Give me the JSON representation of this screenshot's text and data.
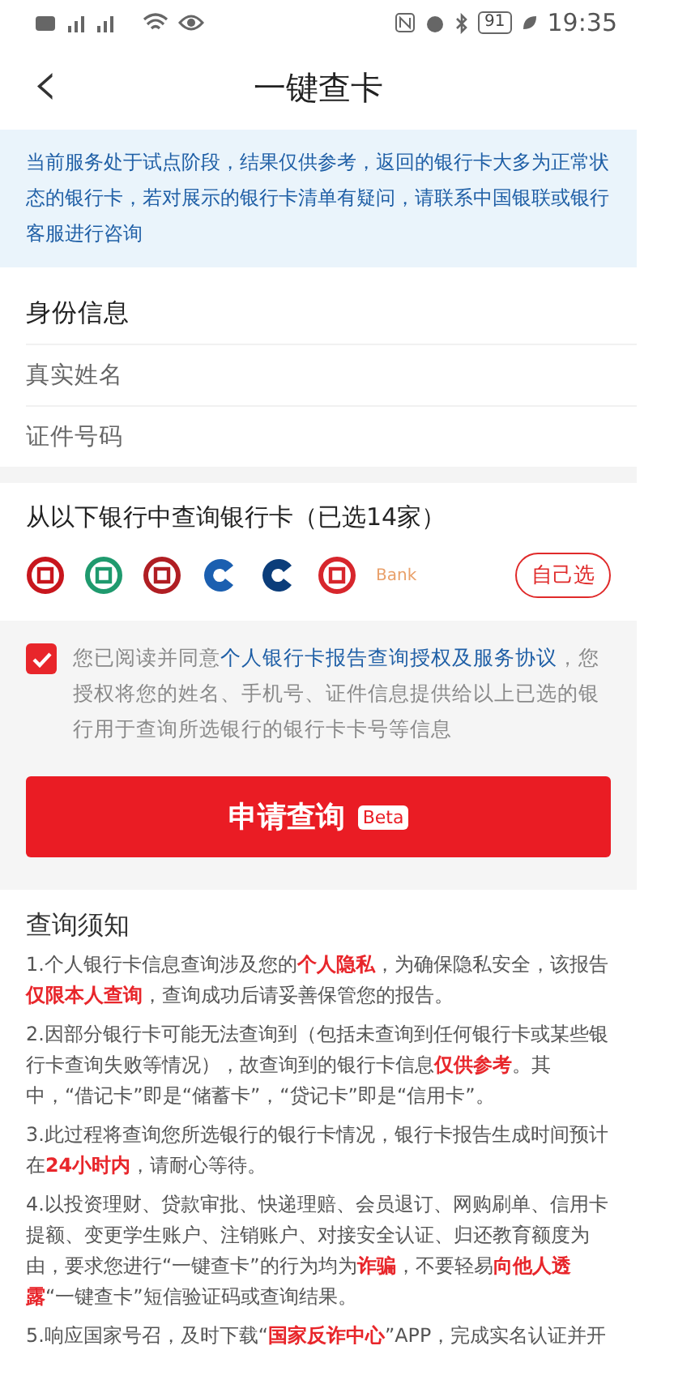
{
  "status_bar": {
    "battery": "91",
    "time": "19:35"
  },
  "nav": {
    "back": "‹",
    "title": "一键查卡"
  },
  "notice": "当前服务处于试点阶段，结果仅供参考，返回的银行卡大多为正常状态的银行卡，若对展示的银行卡清单有疑问，请联系中国银联或银行客服进行咨询",
  "identity": {
    "title": "身份信息",
    "fields": [
      {
        "label": "真实姓名"
      },
      {
        "label": "证件号码"
      }
    ]
  },
  "banks": {
    "title": "从以下银行中查询银行卡（已选14家）",
    "items": [
      {
        "kind": "ring",
        "color": "#c8161d"
      },
      {
        "kind": "ring",
        "color": "#1f9a6e"
      },
      {
        "kind": "ring",
        "color": "#b01e23"
      },
      {
        "kind": "swoosh",
        "color": "#1b5fb0"
      },
      {
        "kind": "swoosh",
        "color": "#0b3d7a"
      },
      {
        "kind": "ring",
        "color": "#d7262c"
      },
      {
        "kind": "text",
        "color": "#e9a06a",
        "label": "Bank"
      }
    ],
    "choose_button": "自己选"
  },
  "agreement": {
    "checked": true,
    "prefix": "您已阅读并同意",
    "link": "个人银行卡报告查询授权及服务协议",
    "suffix": "，您授权将您的姓名、手机号、证件信息提供给以上已选的银行用于查询所选银行的银行卡卡号等信息"
  },
  "submit": {
    "label": "申请查询",
    "badge": "Beta"
  },
  "notes": {
    "title": "查询须知",
    "items": [
      "1.个人银行卡信息查询涉及您的**个人隐私**，为确保隐私安全，该报告**仅限本人查询**，查询成功后请妥善保管您的报告。",
      "2.因部分银行卡可能无法查询到（包括未查询到任何银行卡或某些银行卡查询失败等情况），故查询到的银行卡信息**仅供参考**。其中，“借记卡”即是“储蓄卡”，“贷记卡”即是“信用卡”。",
      "3.此过程将查询您所选银行的银行卡情况，银行卡报告生成时间预计在**24小时内**，请耐心等待。",
      "4.以投资理财、贷款审批、快递理赔、会员退订、网购刷单、信用卡提额、变更学生账户、注销账户、对接安全认证、归还教育额度为由，要求您进行“一键查卡”的行为均为**诈骗**，不要轻易**向他人透露**“一键查卡”短信验证码或查询结果。",
      "5.响应国家号召，及时下载“**国家反诈中心**”APP，完成实名认证并开"
    ]
  }
}
